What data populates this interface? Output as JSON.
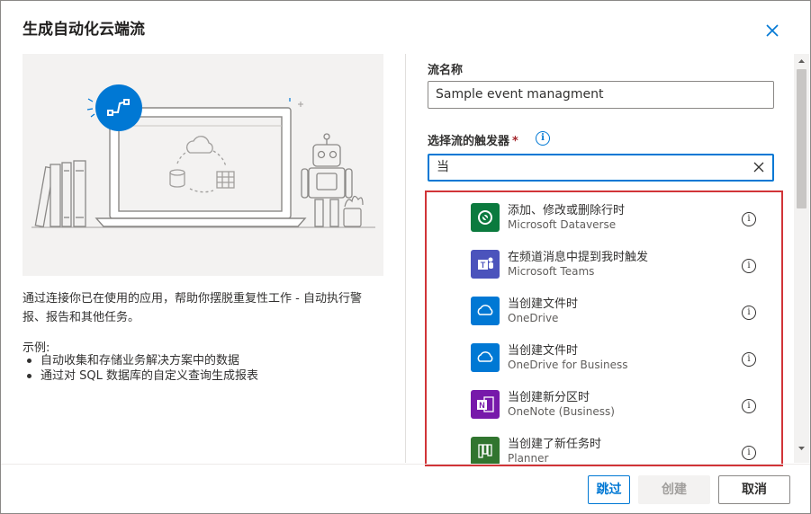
{
  "dialog": {
    "title": "生成自动化云端流",
    "description": "通过连接你已在使用的应用，帮助你摆脱重复性工作 - 自动执行警报、报告和其他任务。",
    "examples_heading": "示例:",
    "examples": [
      "自动收集和存储业务解决方案中的数据",
      "通过对 SQL 数据库的自定义查询生成报表"
    ]
  },
  "form": {
    "flow_name_label": "流名称",
    "flow_name_value": "Sample event managment",
    "trigger_label": "选择流的触发器",
    "required_mark": "*",
    "search_value": "当"
  },
  "triggers": [
    {
      "title": "添加、修改或删除行时",
      "connector": "Microsoft Dataverse",
      "icon": "dataverse-icon",
      "color": "#0b7a3e"
    },
    {
      "title": "在频道消息中提到我时触发",
      "connector": "Microsoft Teams",
      "icon": "teams-icon",
      "color": "#4b53bc"
    },
    {
      "title": "当创建文件时",
      "connector": "OneDrive",
      "icon": "onedrive-icon",
      "color": "#0078d4"
    },
    {
      "title": "当创建文件时",
      "connector": "OneDrive for Business",
      "icon": "onedrive-icon",
      "color": "#0078d4"
    },
    {
      "title": "当创建新分区时",
      "connector": "OneNote (Business)",
      "icon": "onenote-icon",
      "color": "#7719aa"
    },
    {
      "title": "当创建了新任务时",
      "connector": "Planner",
      "icon": "planner-icon",
      "color": "#31752f"
    }
  ],
  "buttons": {
    "skip": "跳过",
    "create": "创建",
    "cancel": "取消"
  },
  "colors": {
    "accent": "#0078d4",
    "highlight_border": "#d13438"
  }
}
